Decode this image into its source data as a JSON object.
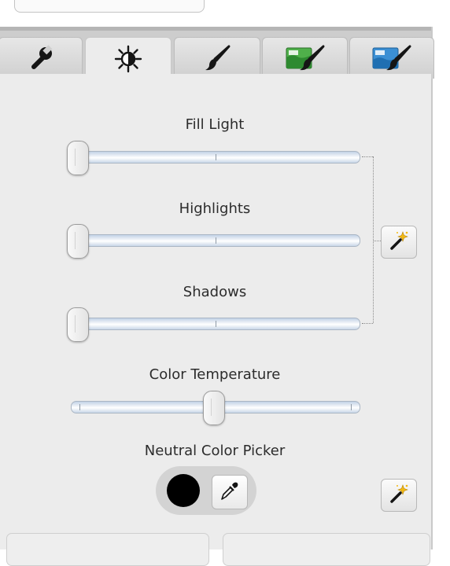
{
  "tabs": [
    {
      "icon": "wrench-icon",
      "selected": false
    },
    {
      "icon": "brightness-icon",
      "selected": true
    },
    {
      "icon": "brush-icon",
      "selected": false
    },
    {
      "icon": "green-brush-icon",
      "selected": false
    },
    {
      "icon": "blue-brush-icon",
      "selected": false
    }
  ],
  "adjustments": {
    "fill_light": {
      "label": "Fill Light",
      "value": 0
    },
    "highlights": {
      "label": "Highlights",
      "value": 0
    },
    "shadows": {
      "label": "Shadows",
      "value": 0
    },
    "color_temperature": {
      "label": "Color Temperature",
      "value": 0.5
    }
  },
  "auto_button_icon": "magic-wand-icon",
  "neutral_color_picker": {
    "label": "Neutral Color Picker",
    "swatch_color": "#000000",
    "picker_icon": "eyedropper-icon"
  },
  "colors": {
    "panel": "#ececec",
    "tab_bar": "#cdcdcd",
    "track_blue": "#c2d2e6"
  }
}
